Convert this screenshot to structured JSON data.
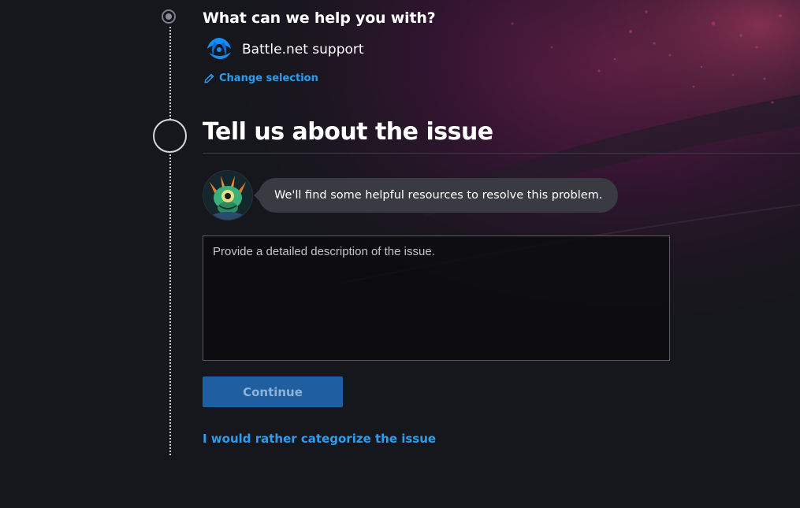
{
  "step1": {
    "title": "What can we help you with?",
    "selection_icon": "battlenet-icon",
    "selection_label": "Battle.net support",
    "change_selection_label": "Change selection"
  },
  "step2": {
    "title": "Tell us about the issue",
    "avatar_icon": "murloc-avatar",
    "message": "We'll find some helpful resources to resolve this problem.",
    "description_placeholder": "Provide a detailed description of the issue.",
    "description_value": "",
    "continue_label": "Continue",
    "categorize_label": "I would rather categorize the issue"
  },
  "colors": {
    "background": "#16171c",
    "accent_link": "#2b9ef0",
    "button_disabled": "#1f5e9f",
    "bubble": "#3a3b42"
  }
}
